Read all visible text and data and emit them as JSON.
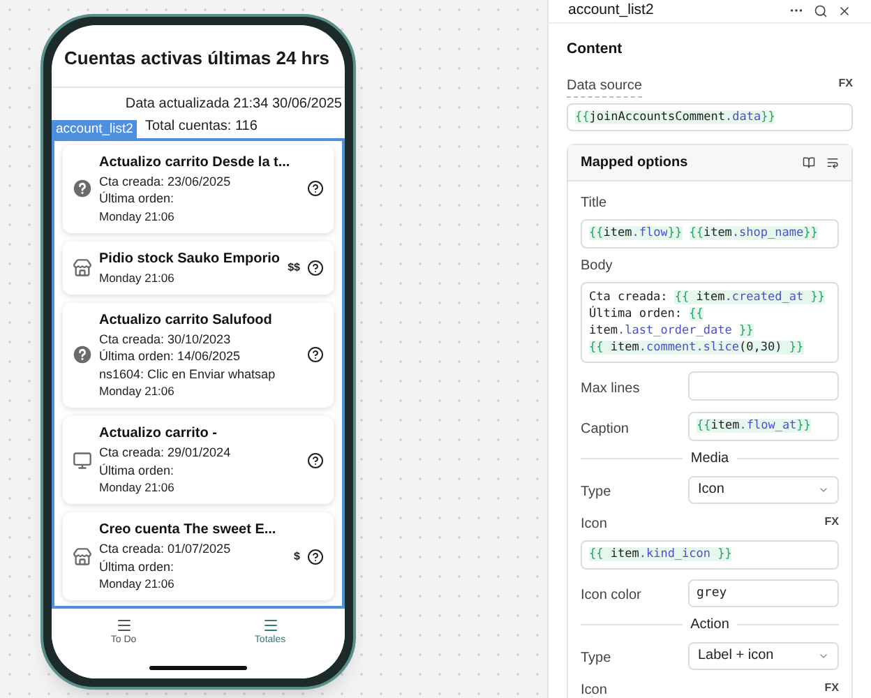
{
  "phone": {
    "title": "Cuentas activas últimas 24 hrs",
    "updated": "Data actualizada 21:34 30/06/2025",
    "total": "Total cuentas: 116",
    "component_tag": "account_list2",
    "cards": [
      {
        "kind": "question",
        "title": "Actualizo carrito Desde la t...",
        "lines": [
          "Cta creada: 23/06/2025",
          "Última orden:"
        ],
        "caption": "Monday 21:06"
      },
      {
        "kind": "store",
        "title": "Pidio stock Sauko Emporio",
        "caption": "Monday 21:06",
        "label": "$$"
      },
      {
        "kind": "question",
        "title": "Actualizo carrito Salufood",
        "lines": [
          "Cta creada: 30/10/2023",
          "Última orden: 14/06/2025",
          "ns1604: Clic en Enviar whatsap"
        ],
        "caption": "Monday 21:06"
      },
      {
        "kind": "monitor",
        "title": "Actualizo carrito -",
        "lines": [
          "Cta creada: 29/01/2024",
          "Última orden:"
        ],
        "caption": "Monday 21:06"
      },
      {
        "kind": "store",
        "title": "Creo cuenta The sweet E...",
        "lines": [
          "Cta creada: 01/07/2025",
          "Última orden:"
        ],
        "caption": "Monday 21:06",
        "label": "$"
      }
    ],
    "nav": [
      {
        "label": "To Do",
        "selected": false
      },
      {
        "label": "Totales",
        "selected": true
      }
    ]
  },
  "panel": {
    "title": "account_list2",
    "section": "Content",
    "data_source": {
      "label": "Data source",
      "fx": "FX",
      "value": "{{joinAccountsComment.data}}"
    },
    "mapped": {
      "title": "Mapped options",
      "fields": [
        {
          "kind": "code",
          "label": "Title",
          "lines": [
            "{{item.flow}} {{item.shop_name}}"
          ]
        },
        {
          "kind": "multiline",
          "label": "Body",
          "lines": [
            "Cta creada: {{ item.created_at }}",
            "Última orden: {{",
            "item.last_order_date }}",
            "{{ item.comment.slice(0,30) }}"
          ]
        },
        {
          "kind": "inline",
          "label": "Max lines"
        },
        {
          "kind": "inline",
          "label": "Caption",
          "lines": [
            "{{item.flow_at}}"
          ]
        },
        {
          "kind": "divider",
          "label": "Media"
        },
        {
          "kind": "select",
          "label": "Type",
          "value": "Icon"
        },
        {
          "kind": "fx",
          "label": "Icon",
          "fx": "FX",
          "lines": [
            "{{  item.kind_icon }}"
          ]
        },
        {
          "kind": "plain",
          "label": "Icon color",
          "value": "grey"
        },
        {
          "kind": "divider",
          "label": "Action"
        },
        {
          "kind": "select",
          "label": "Type",
          "value": "Label + icon"
        },
        {
          "kind": "fx",
          "label": "Icon",
          "fx": "FX"
        }
      ]
    }
  }
}
